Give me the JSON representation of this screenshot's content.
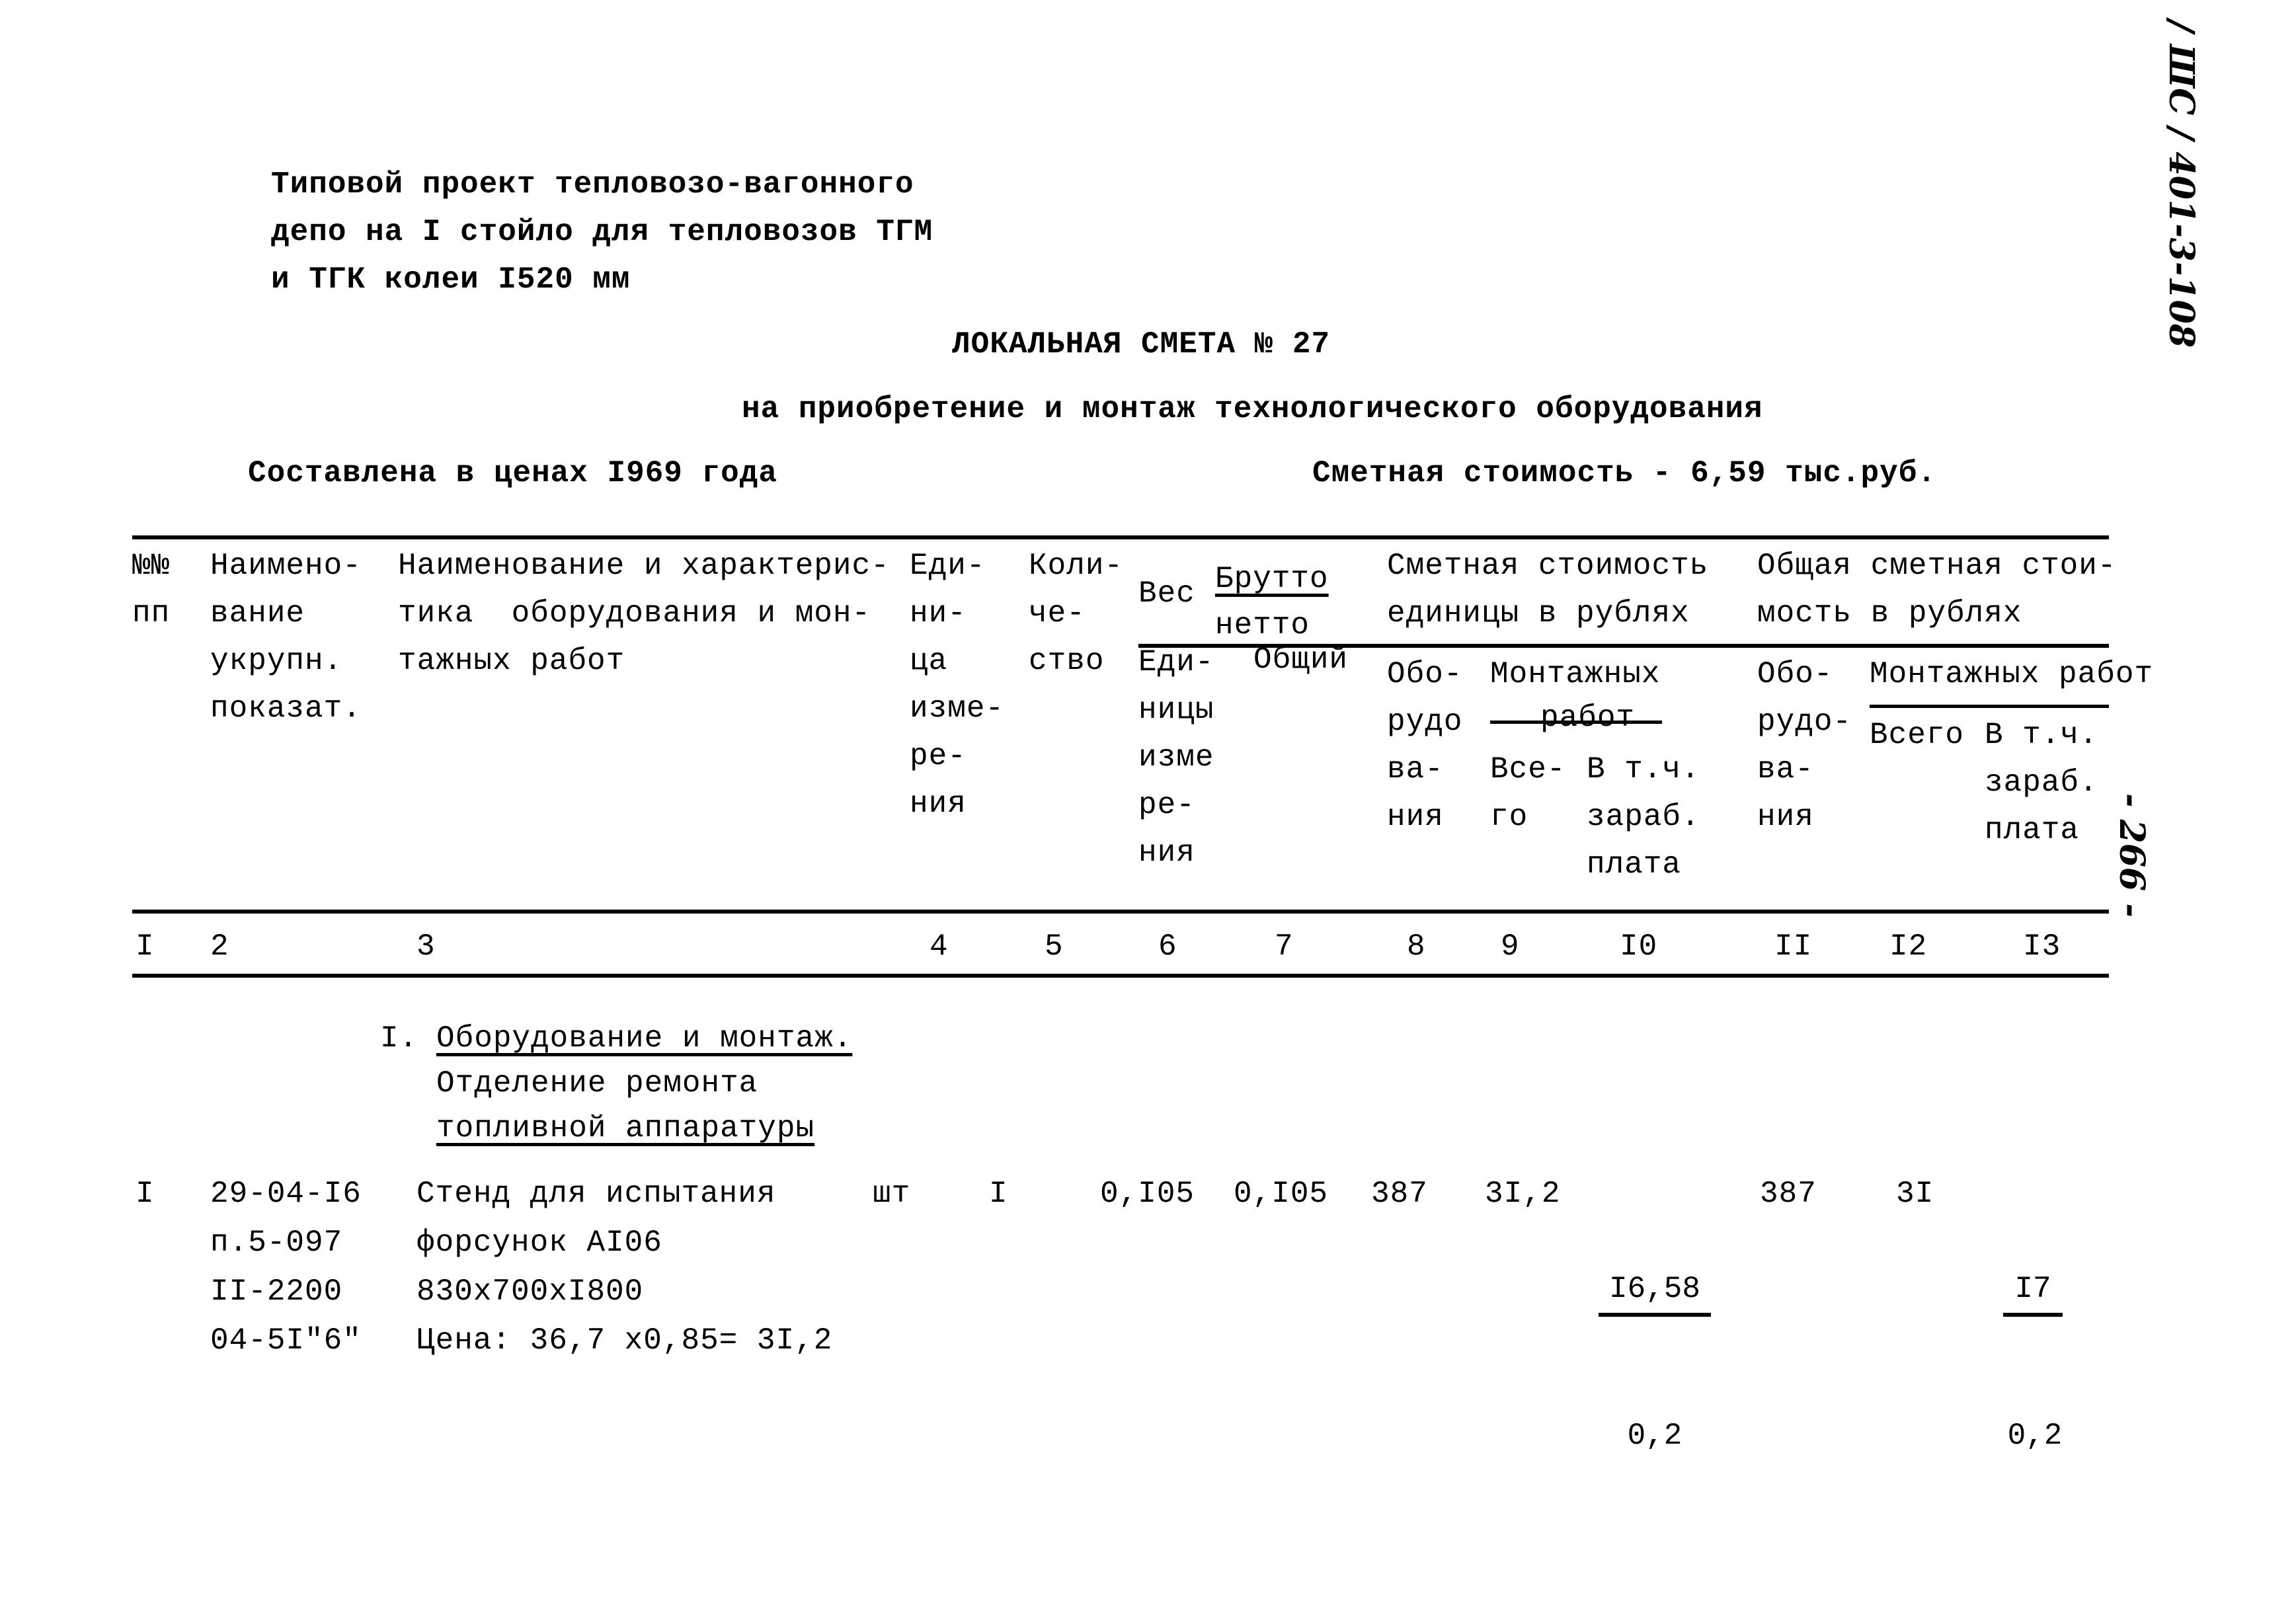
{
  "project_header": [
    "Типовой проект тепловозо-вагонного",
    "депо на I стойло для тепловозов ТГМ",
    "и ТГК колеи I520 мм"
  ],
  "title": "ЛОКАЛЬНАЯ СМЕТА № 27",
  "subtitle": "на приобретение и монтаж технологического оборудования",
  "prices_basis": "Составлена в ценах I969 года",
  "estimated_cost": "Сметная стоимость - 6,59 тыс.руб.",
  "margin_notes": {
    "project_code": "/ ШС / 401-3-108",
    "page_number": "- 266 -"
  },
  "table": {
    "headers": {
      "col1": [
        "№№",
        "пп"
      ],
      "col2": [
        "Наимено-",
        "вание",
        "укрупн.",
        "показат."
      ],
      "col3": [
        "Наименование и характерис-",
        "тика  оборудования и мон-",
        "тажных работ"
      ],
      "col4": [
        "Еди-",
        "ни-",
        "ца",
        "изме-",
        "ре-",
        "ния"
      ],
      "col5": [
        "Коли-",
        "че-",
        "ство"
      ],
      "weight": {
        "label": "Вес",
        "brutto": "Брутто",
        "netto": "нетто"
      },
      "col6": [
        "Еди-",
        "ницы",
        "изме",
        "ре-",
        "ния"
      ],
      "col7": [
        "Общий"
      ],
      "unit_cost_group": [
        "Сметная стоимость",
        "единицы в рублях"
      ],
      "col8": [
        "Обо-",
        "рудо",
        "ва-",
        "ния"
      ],
      "install_unit_group": [
        "Монтажных",
        "работ"
      ],
      "col9": [
        "Все-",
        "го"
      ],
      "col10": [
        "В т.ч.",
        "зараб.",
        "плата"
      ],
      "total_cost_group": [
        "Общая сметная стои-",
        "мость в рублях"
      ],
      "col11": [
        "Обо-",
        "рудо-",
        "ва-",
        "ния"
      ],
      "install_total_group": "Монтажных работ",
      "col12": [
        "Всего"
      ],
      "col13": [
        "В т.ч.",
        "зараб.",
        "плата"
      ]
    },
    "column_numbers": [
      "I",
      "2",
      "3",
      "4",
      "5",
      "6",
      "7",
      "8",
      "9",
      "I0",
      "II",
      "I2",
      "I3"
    ],
    "section": {
      "number": "I.",
      "title": "Оборудование и монтаж.",
      "subtitle_line1": "Отделение ремонта",
      "subtitle_line2": "топливной аппаратуры"
    },
    "rows": [
      {
        "num": "I",
        "indicator": [
          "29-04-I6",
          "п.5-097",
          "II-2200",
          "04-5I\"6\""
        ],
        "description": [
          "Стенд для испытания",
          "форсунок АI06",
          "830х700хI800",
          "Цена: 36,7 х0,85= 3I,2"
        ],
        "unit": "шт",
        "quantity": "I",
        "weight_unit": "0,I05",
        "weight_total": "0,I05",
        "unit_equipment": "387",
        "unit_install_total": "3I,2",
        "unit_install_wages": {
          "top": "I6,58",
          "bottom": "0,2"
        },
        "total_equipment": "387",
        "total_install": "3I",
        "total_install_wages": {
          "top": "I7",
          "bottom": "0,2"
        }
      }
    ]
  }
}
